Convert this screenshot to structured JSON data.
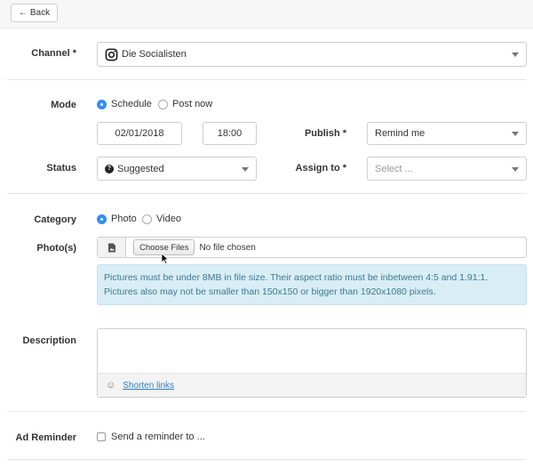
{
  "toolbar": {
    "back_label": "Back"
  },
  "channel": {
    "label": "Channel *",
    "value": "Die Socialisten",
    "icon": "instagram-icon"
  },
  "mode": {
    "label": "Mode",
    "options": [
      "Schedule",
      "Post now"
    ],
    "selected": "Schedule"
  },
  "date": {
    "value": "02/01/2018"
  },
  "time": {
    "value": "18:00"
  },
  "publish": {
    "label": "Publish *",
    "value": "Remind me"
  },
  "status": {
    "label": "Status",
    "value": "Suggested"
  },
  "assign": {
    "label": "Assign to *",
    "placeholder": "Select ..."
  },
  "category": {
    "label": "Category",
    "options": [
      "Photo",
      "Video"
    ],
    "selected": "Photo"
  },
  "photos": {
    "label": "Photo(s)",
    "choose_label": "Choose Files",
    "no_file": "No file chosen",
    "info_line1": "Pictures must be under 8MB in file size. Their aspect ratio must be inbetween 4:5 and 1.91:1.",
    "info_line2": "Pictures also may not be smaller than 150x150 or bigger than 1920x1080 pixels."
  },
  "description": {
    "label": "Description",
    "footer_link": "Shorten links"
  },
  "ad_reminder": {
    "label": "Ad Reminder",
    "checkbox_label": "Send a reminder to ..."
  },
  "colors": {
    "accent": "#2f8ef4",
    "info_bg": "#d9edf5",
    "info_text": "#3a7a93"
  }
}
